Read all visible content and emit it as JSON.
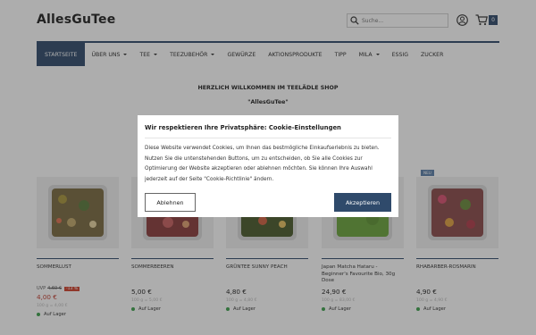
{
  "header": {
    "logo": "AllesGuTee",
    "search_placeholder": "Suche...",
    "cart_count": "0"
  },
  "nav": {
    "items": [
      {
        "label": "STARTSEITE",
        "active": true,
        "dropdown": false
      },
      {
        "label": "ÜBER UNS",
        "active": false,
        "dropdown": true
      },
      {
        "label": "TEE",
        "active": false,
        "dropdown": true
      },
      {
        "label": "TEEZUBEHÖR",
        "active": false,
        "dropdown": true
      },
      {
        "label": "GEWÜRZE",
        "active": false,
        "dropdown": false
      },
      {
        "label": "AKTIONSPRODUKTE",
        "active": false,
        "dropdown": false
      },
      {
        "label": "TIPP",
        "active": false,
        "dropdown": false
      },
      {
        "label": "MILA",
        "active": false,
        "dropdown": true
      },
      {
        "label": "ESSIG",
        "active": false,
        "dropdown": false
      },
      {
        "label": "ZUCKER",
        "active": false,
        "dropdown": false
      }
    ]
  },
  "welcome": {
    "line1": "HERZLICH WILLKOMMEN IM TEELÄDLE SHOP",
    "line2": "\"AllesGuTee\""
  },
  "products": [
    {
      "name": "SOMMERLUST",
      "uvp_label": "UVP",
      "uvp": "4,60 €",
      "discount": "-13 %",
      "price": "4,00 €",
      "base_price": "100 g = 4,00 €",
      "stock": "Auf Lager",
      "badge": "",
      "color": "#7a6a40"
    },
    {
      "name": "SOMMERBEEREN",
      "uvp_label": "",
      "uvp": "",
      "discount": "",
      "price": "5,00 €",
      "base_price": "100 g = 5,00 €",
      "stock": "Auf Lager",
      "badge": "",
      "color": "#8a3a3a"
    },
    {
      "name": "GRÜNTEE SUNNY PEACH",
      "uvp_label": "",
      "uvp": "",
      "discount": "",
      "price": "4,80 €",
      "base_price": "100 g = 4,80 €",
      "stock": "Auf Lager",
      "badge": "",
      "color": "#5a6a2a"
    },
    {
      "name": "Japan Matcha Hataru - Beginner's Favourite Bio, 30g Dose",
      "uvp_label": "",
      "uvp": "",
      "discount": "",
      "price": "24,90 €",
      "base_price": "100 g = 83,00 €",
      "stock": "Auf Lager",
      "badge": "",
      "color": "#6aa33a"
    },
    {
      "name": "RHABARBER-ROSMARIN",
      "uvp_label": "",
      "uvp": "",
      "discount": "",
      "price": "4,90 €",
      "base_price": "100 g = 4,90 €",
      "stock": "Auf Lager",
      "badge": "NEU",
      "color": "#8a4a4a"
    }
  ],
  "cookie": {
    "title": "Wir respektieren Ihre Privatsphäre: Cookie-Einstellungen",
    "text": "Diese Website verwendet Cookies, um Ihnen das bestmögliche Einkaufserlebnis zu bieten. Nutzen Sie die untenstehenden Buttons, um zu entscheiden, ob Sie alle Cookies zur Optimierung der Website akzeptieren oder ablehnen möchten. Sie können Ihre Auswahl jederzeit auf der Seite \"Cookie-Richtlinie\" ändern.",
    "decline_label": "Ablehnen",
    "accept_label": "Akzeptieren"
  },
  "colors": {
    "brand": "#2f4a6b",
    "sale": "#c0392b",
    "stock": "#3aa14b"
  }
}
